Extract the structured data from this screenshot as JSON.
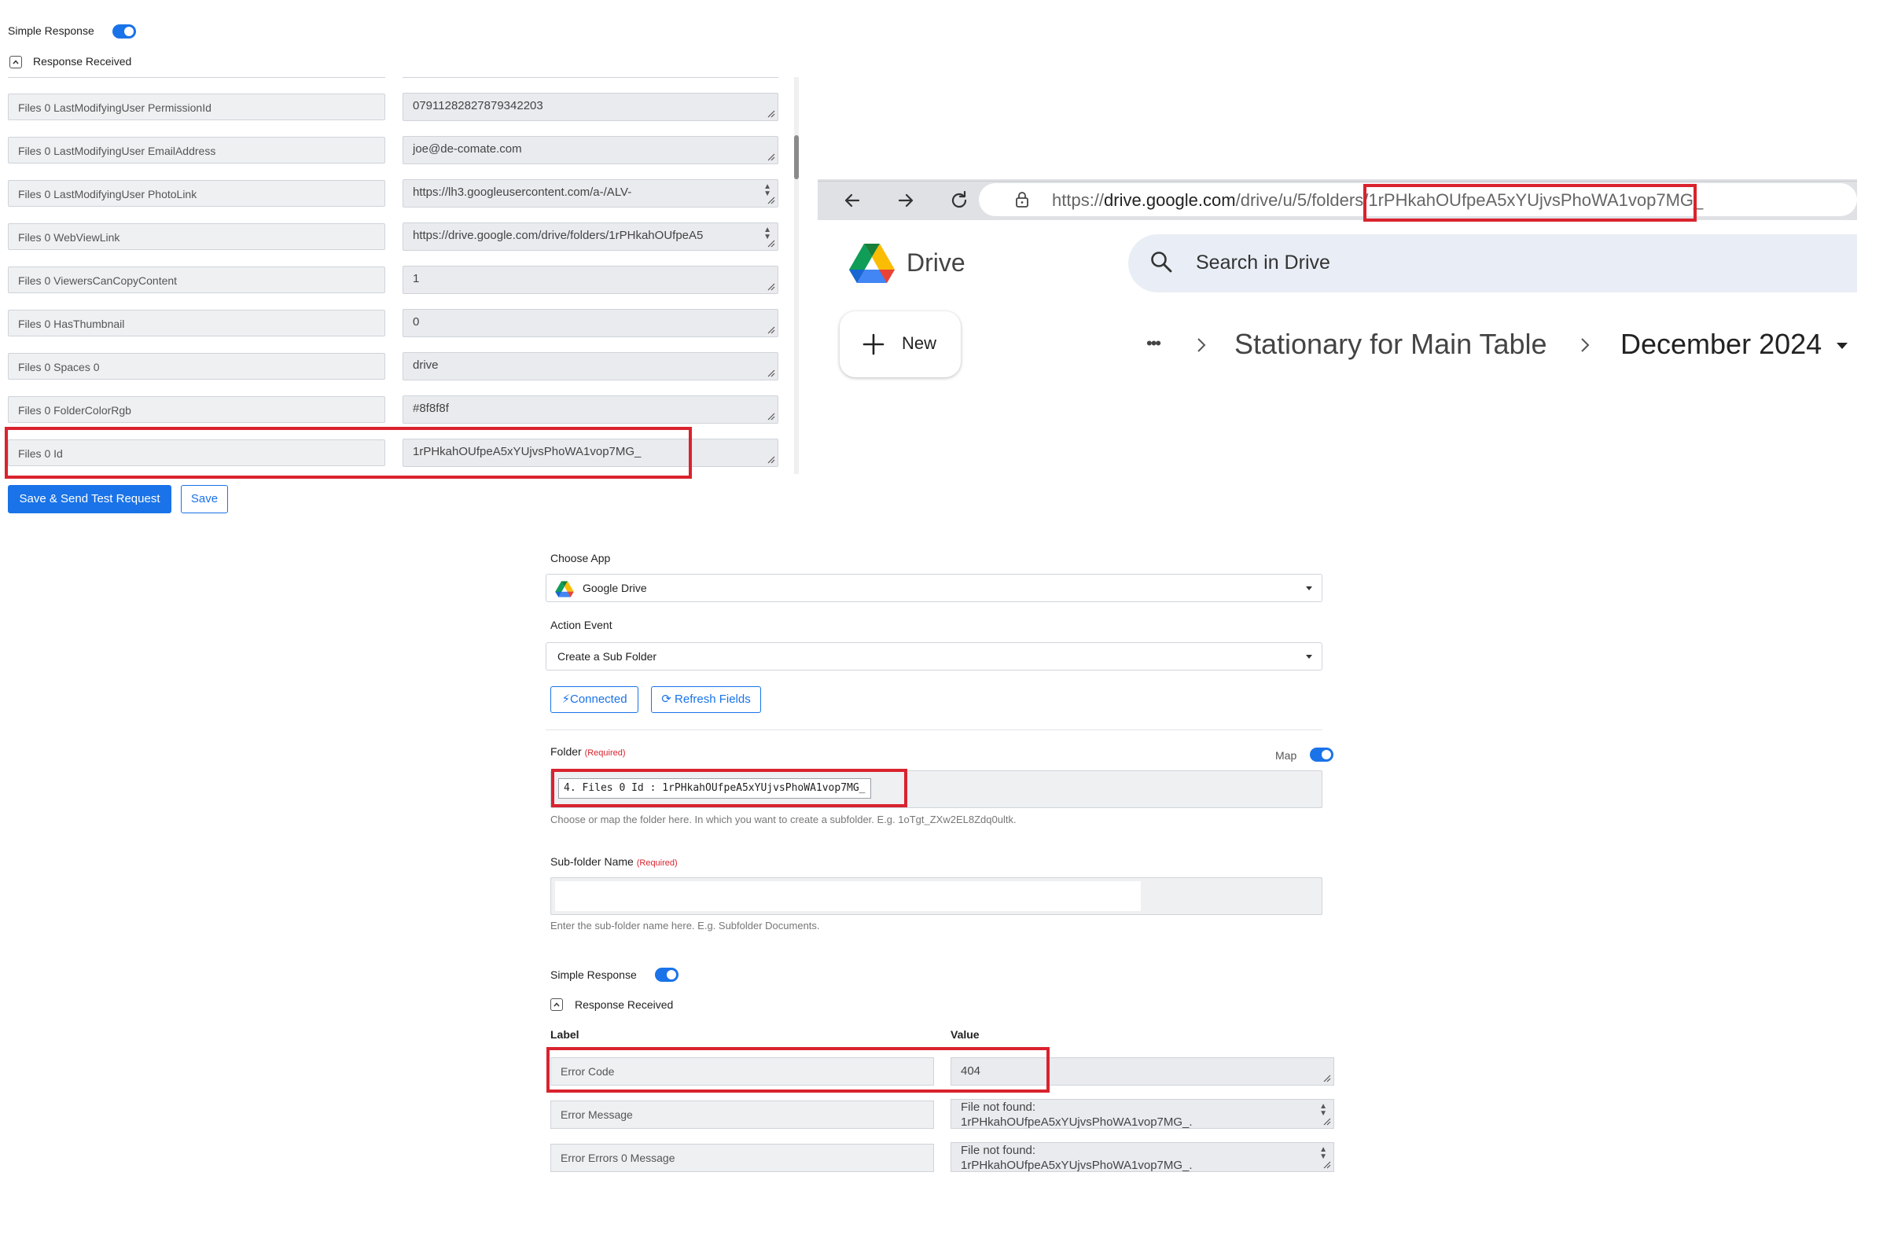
{
  "panel1": {
    "simple_response_label": "Simple Response",
    "response_received_label": "Response Received",
    "rows": [
      {
        "label": "Files 0 LastModifyingUser PermissionId",
        "value": "07911282827879342203"
      },
      {
        "label": "Files 0 LastModifyingUser EmailAddress",
        "value": "joe@de-comate.com"
      },
      {
        "label": "Files 0 LastModifyingUser PhotoLink",
        "value": "https://lh3.googleusercontent.com/a-/ALV-"
      },
      {
        "label": "Files 0 WebViewLink",
        "value": "https://drive.google.com/drive/folders/1rPHkahOUfpeA5"
      },
      {
        "label": "Files 0 ViewersCanCopyContent",
        "value": "1"
      },
      {
        "label": "Files 0 HasThumbnail",
        "value": "0"
      },
      {
        "label": "Files 0 Spaces 0",
        "value": "drive"
      },
      {
        "label": "Files 0 FolderColorRgb",
        "value": "#8f8f8f"
      },
      {
        "label": "Files 0 Id",
        "value": "1rPHkahOUfpeA5xYUjvsPhoWA1vop7MG_"
      }
    ],
    "save_send_label": "Save & Send Test Request",
    "save_label": "Save"
  },
  "browser": {
    "url_prefix": "https://",
    "url_domain": "drive.google.com",
    "url_path": "/drive/u/5/folders/",
    "url_id": "1rPHkahOUfpeA5xYUjvsPhoWA1vop7MG_",
    "app_name": "Drive",
    "search_placeholder": "Search in Drive",
    "new_label": "New",
    "breadcrumb_more": "•••",
    "breadcrumb_parent": "Stationary for Main Table",
    "breadcrumb_current": "December 2024"
  },
  "panel3": {
    "choose_app_label": "Choose App",
    "app_value": "Google Drive",
    "action_event_label": "Action Event",
    "action_value": "Create a Sub Folder",
    "connected_label": "Connected",
    "refresh_label": "Refresh Fields",
    "folder_label": "Folder",
    "required_label": "(Required)",
    "map_label": "Map",
    "folder_token": "4. Files 0 Id : 1rPHkahOUfpeA5xYUjvsPhoWA1vop7MG_",
    "folder_hint": "Choose or map the folder here. In which you want to create a subfolder. E.g. 1oTgt_ZXw2EL8Zdq0ultk.",
    "subfolder_label": "Sub-folder Name",
    "subfolder_hint": "Enter the sub-folder name here. E.g. Subfolder Documents.",
    "simple_response_label": "Simple Response",
    "response_received_label": "Response Received",
    "col_label": "Label",
    "col_value": "Value",
    "rows": [
      {
        "label": "Error Code",
        "value": "404"
      },
      {
        "label": "Error Message",
        "value": "File not found:",
        "value2": "1rPHkahOUfpeA5xYUjvsPhoWA1vop7MG_."
      },
      {
        "label": "Error Errors 0 Message",
        "value": "File not found:",
        "value2": "1rPHkahOUfpeA5xYUjvsPhoWA1vop7MG_."
      }
    ]
  },
  "colors": {
    "accent": "#1a73e8",
    "highlight": "#d9232e"
  }
}
